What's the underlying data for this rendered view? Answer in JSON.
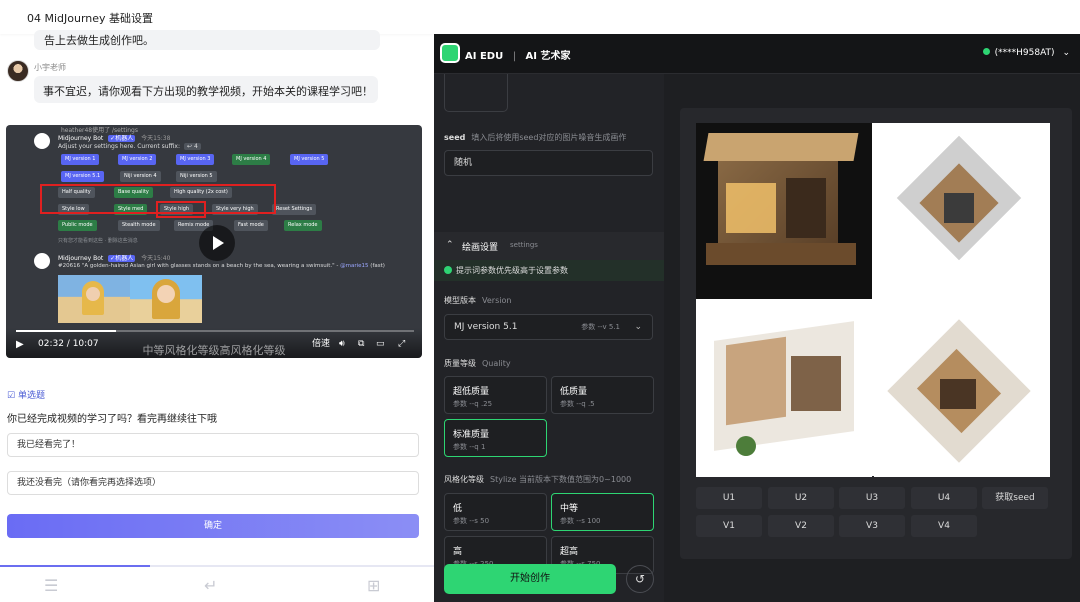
{
  "window": {
    "title": "04 MidJourney 基础设置"
  },
  "chat": {
    "prev_message": "告上去做生成创作吧。",
    "teacher_name": "小宇老师",
    "message": "事不宜迟，请你观看下方出现的教学视频，开始本关的课程学习吧！"
  },
  "video": {
    "top_line": "heather48使用了 /settings",
    "bot_name": "Midjourney Bot",
    "bot_badge": "✓机器人",
    "today": "今天15:38",
    "settings_line": "Adjust your settings here. Current suffix:",
    "reaction": "4",
    "row1": [
      "MJ version 1",
      "MJ version 2",
      "MJ version 3",
      "MJ version 4",
      "MJ version 5"
    ],
    "row2": [
      "MJ version 5.1",
      "Niji version 4",
      "Niji version 5"
    ],
    "row3": [
      "Half quality",
      "Base quality",
      "High quality (2x cost)"
    ],
    "row4": [
      "Style low",
      "Style med",
      "Style high",
      "Style very high",
      "Reset Settings"
    ],
    "row5": [
      "Public mode",
      "Stealth mode",
      "Remix mode",
      "Fast mode",
      "Relax mode"
    ],
    "ephemeral": "只有您才能看到这些 · 删除这些消息",
    "bot2_time": "今天15:40",
    "prompt_line": "#20616 \"A golden-haired Asian girl with glasses stands on a beach by the sea, wearing a swimsuit.\" - ",
    "mention": "@marie15",
    "prompt_suffix": " (fast)",
    "time": "02:32 / 10:07",
    "speed_label": "倍速",
    "progress": 0.25,
    "subtitle": "中等风格化等级高风格化等级"
  },
  "quiz": {
    "type": "单选题",
    "question": "你已经完成视频的学习了吗？看完再继续往下哦",
    "options": [
      "我已经看完了！",
      "我还没看完（请你看完再选择选项）"
    ],
    "confirm": "确定"
  },
  "app": {
    "brand": "AI EDU",
    "product": "AI 艺术家",
    "account": "(****H958AT)"
  },
  "settings": {
    "seed_label": "seed",
    "seed_desc": "填入后将使用seed对应的图片噪音生成画作",
    "seed_value": "随机",
    "section_title": "绘画设置",
    "section_sub": "settings",
    "hint": "提示词参数优先级高于设置参数",
    "model_label": "模型版本",
    "model_sub": "Version",
    "model_value": "MJ version 5.1",
    "model_param": "参数 --v 5.1",
    "quality_label": "质量等级",
    "quality_sub": "Quality",
    "quality": [
      {
        "title": "超低质量",
        "param": "参数 --q .25",
        "selected": false
      },
      {
        "title": "低质量",
        "param": "参数 --q .5",
        "selected": false
      },
      {
        "title": "标准质量",
        "param": "参数 --q 1",
        "selected": true
      }
    ],
    "style_label": "风格化等级",
    "style_sub": "Stylize 当前版本下数值范围为0~1000",
    "style": [
      {
        "title": "低",
        "param": "参数 --s 50",
        "selected": false
      },
      {
        "title": "中等",
        "param": "参数 --s 100",
        "selected": true
      },
      {
        "title": "高",
        "param": "参数 --s 250",
        "selected": false
      },
      {
        "title": "超高",
        "param": "参数 --s 750",
        "selected": false
      }
    ],
    "start": "开始创作"
  },
  "result": {
    "row_u": [
      "U1",
      "U2",
      "U3",
      "U4",
      "获取seed"
    ],
    "row_v": [
      "V1",
      "V2",
      "V3",
      "V4"
    ]
  },
  "colors": {
    "accent": "#2ed573",
    "quiz_accent": "#6b6ef0",
    "dark_bg": "#1e1f22"
  }
}
